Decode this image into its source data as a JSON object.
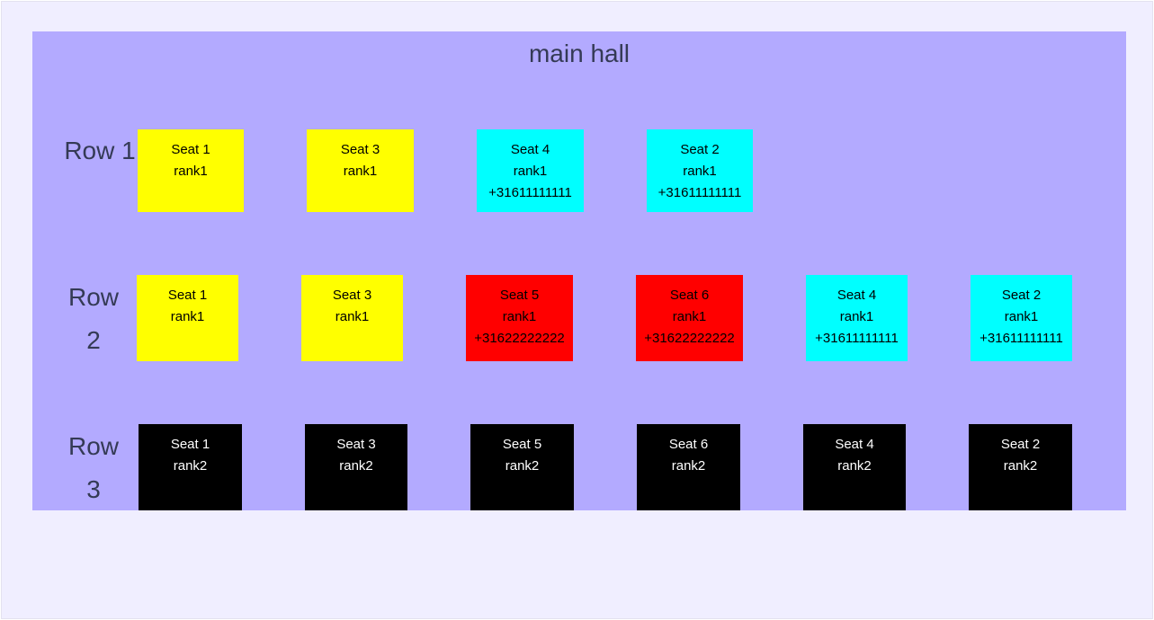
{
  "hall": {
    "title": "main hall"
  },
  "colors": {
    "page_bg": "#f0eeff",
    "hall_bg": "#b3aaff",
    "yellow": "#ffff00",
    "cyan": "#00ffff",
    "red": "#ff0000",
    "black": "#000000",
    "label_text": "#343a55"
  },
  "rows": [
    {
      "label": "Row 1",
      "seats": [
        {
          "name": "Seat 1",
          "rank": "rank1",
          "phone": "",
          "color": "#ffff00",
          "text_color": "#000000"
        },
        {
          "name": "Seat 3",
          "rank": "rank1",
          "phone": "",
          "color": "#ffff00",
          "text_color": "#000000"
        },
        {
          "name": "Seat 4",
          "rank": "rank1",
          "phone": "+31611111111",
          "color": "#00ffff",
          "text_color": "#000000"
        },
        {
          "name": "Seat 2",
          "rank": "rank1",
          "phone": "+31611111111",
          "color": "#00ffff",
          "text_color": "#000000"
        }
      ]
    },
    {
      "label": "Row 2",
      "seats": [
        {
          "name": "Seat 1",
          "rank": "rank1",
          "phone": "",
          "color": "#ffff00",
          "text_color": "#000000"
        },
        {
          "name": "Seat 3",
          "rank": "rank1",
          "phone": "",
          "color": "#ffff00",
          "text_color": "#000000"
        },
        {
          "name": "Seat 5",
          "rank": "rank1",
          "phone": "+31622222222",
          "color": "#ff0000",
          "text_color": "#000000"
        },
        {
          "name": "Seat 6",
          "rank": "rank1",
          "phone": "+31622222222",
          "color": "#ff0000",
          "text_color": "#000000"
        },
        {
          "name": "Seat 4",
          "rank": "rank1",
          "phone": "+31611111111",
          "color": "#00ffff",
          "text_color": "#000000"
        },
        {
          "name": "Seat 2",
          "rank": "rank1",
          "phone": "+31611111111",
          "color": "#00ffff",
          "text_color": "#000000"
        }
      ]
    },
    {
      "label": "Row 3",
      "seats": [
        {
          "name": "Seat 1",
          "rank": "rank2",
          "phone": "",
          "color": "#000000",
          "text_color": "#ffffff"
        },
        {
          "name": "Seat 3",
          "rank": "rank2",
          "phone": "",
          "color": "#000000",
          "text_color": "#ffffff"
        },
        {
          "name": "Seat 5",
          "rank": "rank2",
          "phone": "",
          "color": "#000000",
          "text_color": "#ffffff"
        },
        {
          "name": "Seat 6",
          "rank": "rank2",
          "phone": "",
          "color": "#000000",
          "text_color": "#ffffff"
        },
        {
          "name": "Seat 4",
          "rank": "rank2",
          "phone": "",
          "color": "#000000",
          "text_color": "#ffffff"
        },
        {
          "name": "Seat 2",
          "rank": "rank2",
          "phone": "",
          "color": "#000000",
          "text_color": "#ffffff"
        }
      ]
    }
  ]
}
